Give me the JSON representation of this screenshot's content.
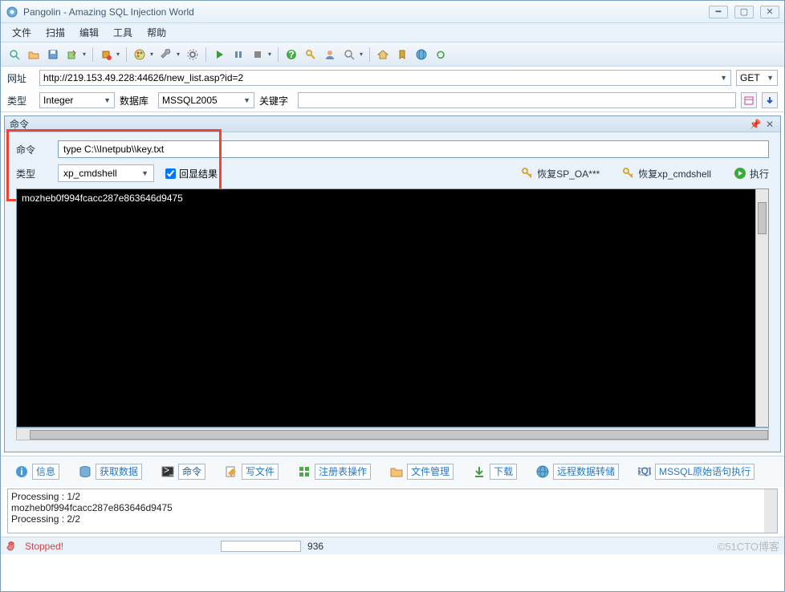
{
  "window": {
    "title": "Pangolin - Amazing SQL Injection World"
  },
  "menu": {
    "file": "文件",
    "scan": "扫描",
    "edit": "编辑",
    "tool": "工具",
    "help": "帮助"
  },
  "url": {
    "label": "网址",
    "value": "http://219.153.49.228:44626/new_list.asp?id=2",
    "method": "GET"
  },
  "type_row": {
    "label": "类型",
    "type_value": "Integer",
    "db_label": "数据库",
    "db_value": "MSSQL2005",
    "keyword_label": "关键字",
    "keyword_value": ""
  },
  "cmd_panel": {
    "title": "命令",
    "cmd_label": "命令",
    "cmd_value": "type C:\\\\Inetpub\\\\key.txt",
    "type_label": "类型",
    "type_value": "xp_cmdshell",
    "echo_label": "回显结果",
    "restore_spoa": "恢复SP_OA***",
    "restore_xpcmd": "恢复xp_cmdshell",
    "execute": "执行",
    "output_line": "mozheb0f994fcacc287e863646d9475"
  },
  "tabs": {
    "info": "信息",
    "fetch": "获取数据",
    "cmd": "命令",
    "writefile": "写文件",
    "registry": "注册表操作",
    "filemgr": "文件管理",
    "download": "下载",
    "remote": "远程数据转储",
    "rawsql": "MSSQL原始语句执行"
  },
  "log": {
    "line1": "Processing : 1/2",
    "line2": "mozheb0f994fcacc287e863646d9475",
    "line3": "Processing : 2/2"
  },
  "status": {
    "stopped": "Stopped!",
    "count": "936",
    "watermark": "©51CTO博客"
  }
}
